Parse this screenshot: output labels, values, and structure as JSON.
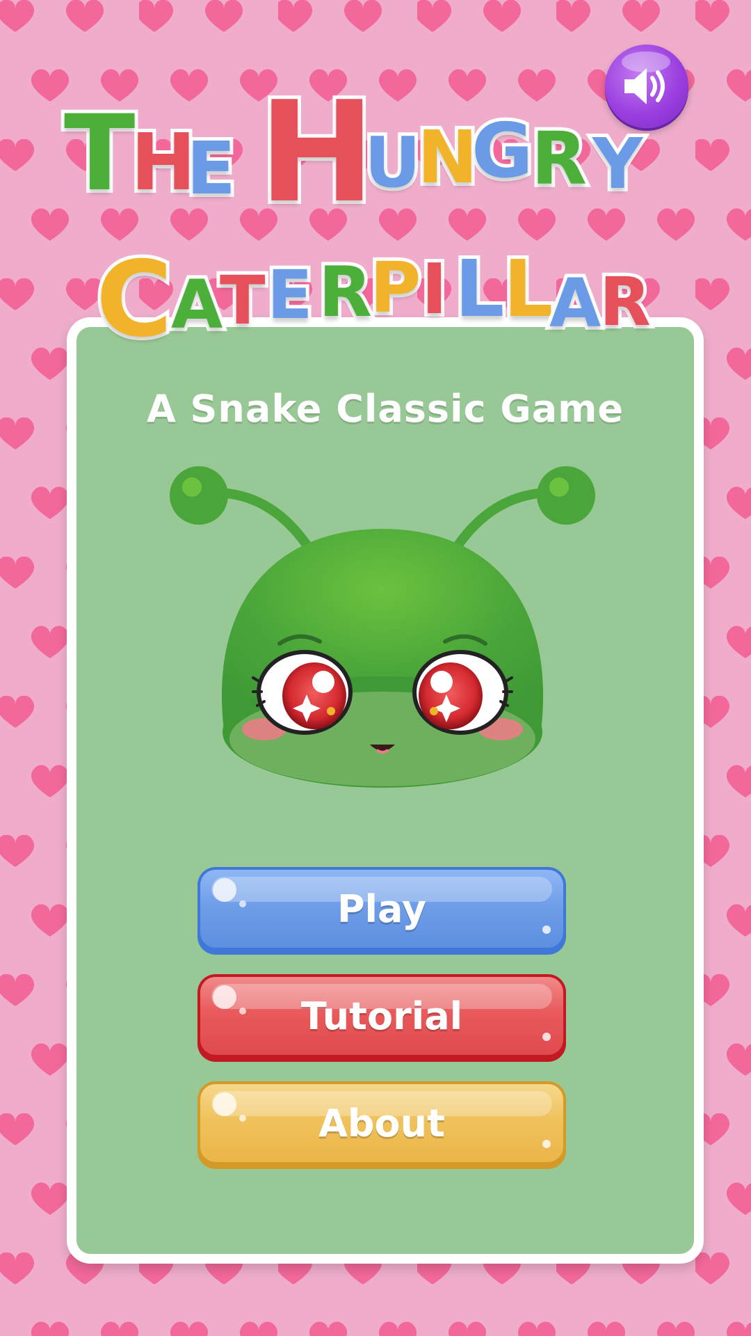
{
  "title": {
    "line1": [
      "T",
      "H",
      "E",
      "H",
      "U",
      "N",
      "G",
      "R",
      "Y"
    ],
    "line2": [
      "C",
      "A",
      "T",
      "E",
      "R",
      "P",
      "I",
      "L",
      "L",
      "A",
      "R"
    ],
    "colors": {
      "green": "#4caf3a",
      "blue": "#6b9be6",
      "red": "#e6505a",
      "yellow": "#f0b32a"
    }
  },
  "subtitle": "A Snake Classic Game",
  "sound_button": {
    "icon": "speaker-icon",
    "state": "on"
  },
  "mascot": {
    "icon": "caterpillar-mascot"
  },
  "menu": {
    "play": "Play",
    "tutorial": "Tutorial",
    "about": "About"
  },
  "colors": {
    "background": "#efadcb",
    "heart": "#f2689a",
    "panel": "#98c895",
    "panel_border": "#ffffff",
    "play": "#6f9ee8",
    "tutorial": "#e85a5c",
    "about": "#f0c25c",
    "sound_button": "#9b3fe0"
  }
}
